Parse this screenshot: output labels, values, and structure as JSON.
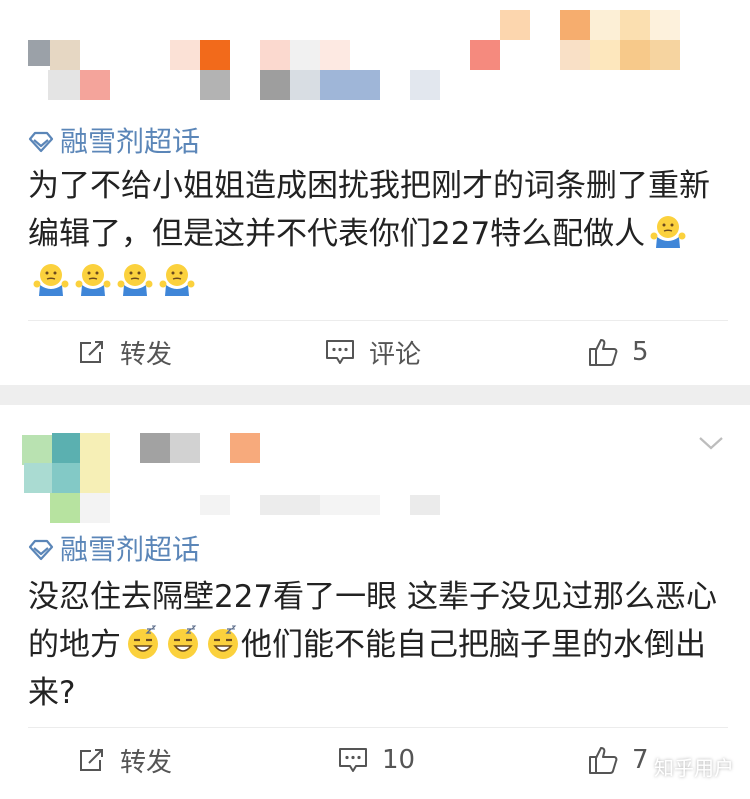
{
  "posts": [
    {
      "topic": "融雪剂超话",
      "text": "为了不给小姐姐造成困扰我把刚才的词条删了重新编辑了，但是这并不代表你们227特么配做人",
      "emoji": "shrug-emoji",
      "emoji_count": 5,
      "actions": {
        "repost": "转发",
        "comment": "评论",
        "like": "5"
      }
    },
    {
      "topic": "融雪剂超话",
      "text_a": "没忍住去隔壁227看了一眼 这辈子没见过那么恶心的地方",
      "emoji": "sleepy-grin-emoji",
      "emoji_count": 3,
      "text_b": "他们能不能自己把脑子里的水倒出来?",
      "actions": {
        "repost": "转发",
        "comment": "10",
        "like": "7"
      }
    }
  ],
  "watermark": "知乎用户",
  "colors": {
    "topic": "#5b86b8",
    "text": "#222222",
    "action": "#555555",
    "background": "#eeeeee"
  }
}
